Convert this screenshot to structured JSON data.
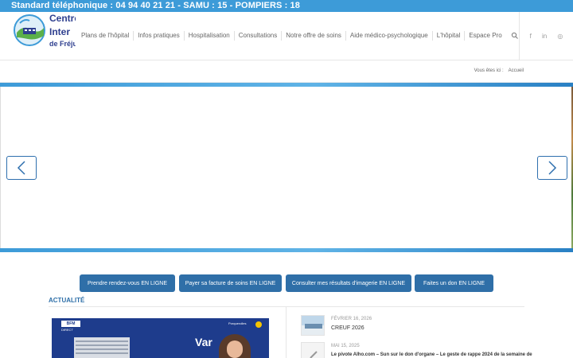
{
  "topbar": {
    "text": "Standard téléphonique : 04 94 40 21 21 - SAMU : 15 - POMPIERS : 18"
  },
  "logo": {
    "line1": "Centre",
    "line2": "Inter",
    "line3": "de Fréjus"
  },
  "nav": {
    "items": [
      {
        "label": "Plans de l'hôpital"
      },
      {
        "label": "Infos pratiques"
      },
      {
        "label": "Hospitalisation"
      },
      {
        "label": "Consultations"
      },
      {
        "label": "Notre offre de soins"
      },
      {
        "label": "Aide médico-psychologique"
      },
      {
        "label": "L'hôpital"
      },
      {
        "label": "Espace Pro"
      }
    ],
    "search_icon": "search-icon"
  },
  "social": {
    "facebook": "f",
    "linkedin": "in",
    "instagram": "◎"
  },
  "breadcrumb": {
    "prefix": "Vous êtes ici :",
    "current": "Accueil"
  },
  "slider": {
    "prev_icon": "chevron-left-icon",
    "next_icon": "chevron-right-icon"
  },
  "cta": [
    {
      "label": "Prendre rendez-vous EN LIGNE"
    },
    {
      "label": "Payer sa facture de soins EN LIGNE"
    },
    {
      "label": "Consulter mes résultats d'imagerie EN LIGNE"
    },
    {
      "label": "Faites un don EN LIGNE"
    }
  ],
  "news": {
    "section_title": "ACTUALITÉ",
    "featured": {
      "brand": "BFM",
      "brand_sub": "DIRECT",
      "overlay": "Var",
      "city": "Porquerolles"
    },
    "items": [
      {
        "date": "FÉVRIER 16, 2026",
        "title": "CREUF 2026"
      },
      {
        "date": "MAI 15, 2025",
        "title": "Le pivote Alho.com – Sun sur le don d'organe – Le geste de rappe 2024 de la semaine de"
      }
    ]
  },
  "colors": {
    "brand_blue": "#3d9bd8",
    "cta_blue": "#2f6fa8",
    "logo_navy": "#2e3f8f"
  }
}
